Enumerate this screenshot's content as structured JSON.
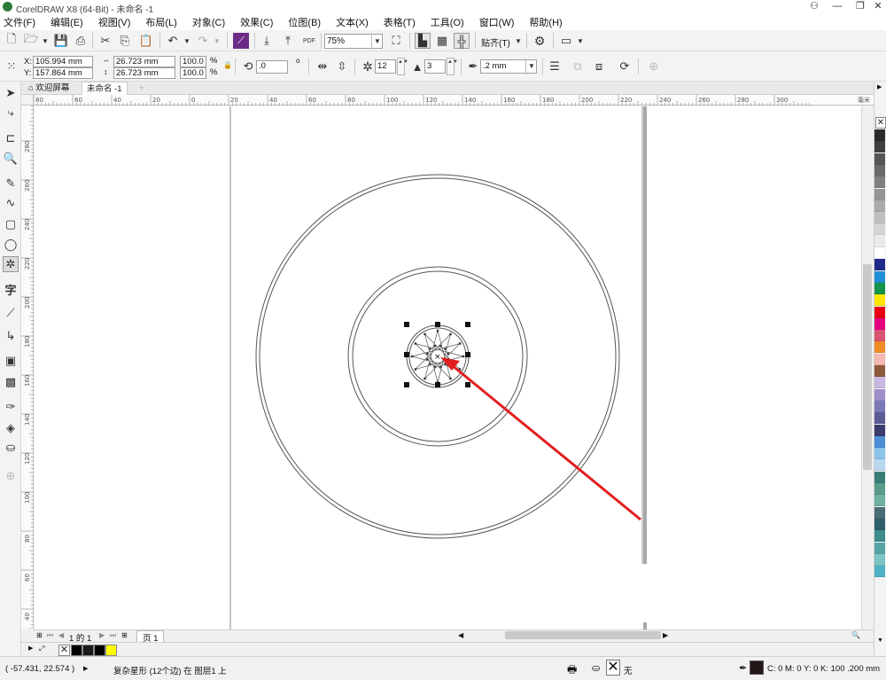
{
  "window": {
    "title": "CorelDRAW X8 (64-Bit) - 未命名 -1",
    "minimize": "—",
    "restore": "❐",
    "close": "✕",
    "help_icon": "person-icon"
  },
  "menu": [
    "文件(F)",
    "编辑(E)",
    "视图(V)",
    "布局(L)",
    "对象(C)",
    "效果(C)",
    "位图(B)",
    "文本(X)",
    "表格(T)",
    "工具(O)",
    "窗口(W)",
    "帮助(H)"
  ],
  "standard_toolbar": {
    "zoom_level": "75%",
    "snap_label": "贴齐(T)",
    "pdf_label": "PDF"
  },
  "property_bar": {
    "x_label": "X:",
    "x_value": "105.994 mm",
    "y_label": "Y:",
    "y_value": "157.864 mm",
    "width_value": "26.723 mm",
    "height_value": "26.723 mm",
    "scale_x": "100.0",
    "scale_y": "100.0",
    "percent": "%",
    "rotation": ".0",
    "degree": "o",
    "points": "12",
    "sharpness": "3",
    "outline_width": ".2 mm"
  },
  "tabs": [
    {
      "label": "欢迎屏幕",
      "icon": "home-icon"
    },
    {
      "label": "未命名 -1"
    },
    {
      "label": "+"
    }
  ],
  "rulers": {
    "units": "毫米",
    "h_ticks": [
      "80",
      "60",
      "40",
      "20",
      "0",
      "20",
      "40",
      "60",
      "80",
      "100",
      "120",
      "140",
      "160",
      "180",
      "200",
      "220",
      "240",
      "260",
      "280",
      "300"
    ],
    "v_ticks": [
      "300",
      "280",
      "260",
      "240",
      "220",
      "200",
      "180",
      "160",
      "140",
      "120",
      "100",
      "80",
      "60",
      "40"
    ]
  },
  "page_nav": {
    "page_count": "1 的 1",
    "page_tab": "页 1"
  },
  "document_palette": [
    "#000000",
    "#1a1a1a",
    "#000000",
    "#ffff00"
  ],
  "status": {
    "coords": "( -57.431, 22.574 )",
    "selection": "复杂星形 (12个边) 在 图层1 上",
    "fill_label": "无",
    "outline_info": "C: 0 M: 0 Y: 0 K: 100  .200 mm",
    "outline_color": "#231815"
  },
  "palette_colors": [
    "#2b2b2b",
    "#3f3f3f",
    "#555555",
    "#6a6a6a",
    "#808080",
    "#959595",
    "#aaaaaa",
    "#bfbfbf",
    "#d4d4d4",
    "#eaeaea",
    "#ffffff",
    "#1e2a8a",
    "#1e8fd6",
    "#14934a",
    "#ffe600",
    "#e60012",
    "#e4007f",
    "#d9546f",
    "#f08a24",
    "#f5b7b1",
    "#8e5a3c",
    "#c8b7e0",
    "#9d8fc8",
    "#7b78b8",
    "#5a5a96",
    "#3c3c6e",
    "#4c8ed6",
    "#8cc3ea",
    "#b8d8ef",
    "#3a7d78",
    "#5a9b8a",
    "#6fb0a0",
    "#4a6d74",
    "#2e5f6a",
    "#3d8b8b",
    "#56a5a5",
    "#7cc4c4",
    "#4fb0c6"
  ],
  "annotation": {
    "arrow_color": "#e21e1e"
  }
}
